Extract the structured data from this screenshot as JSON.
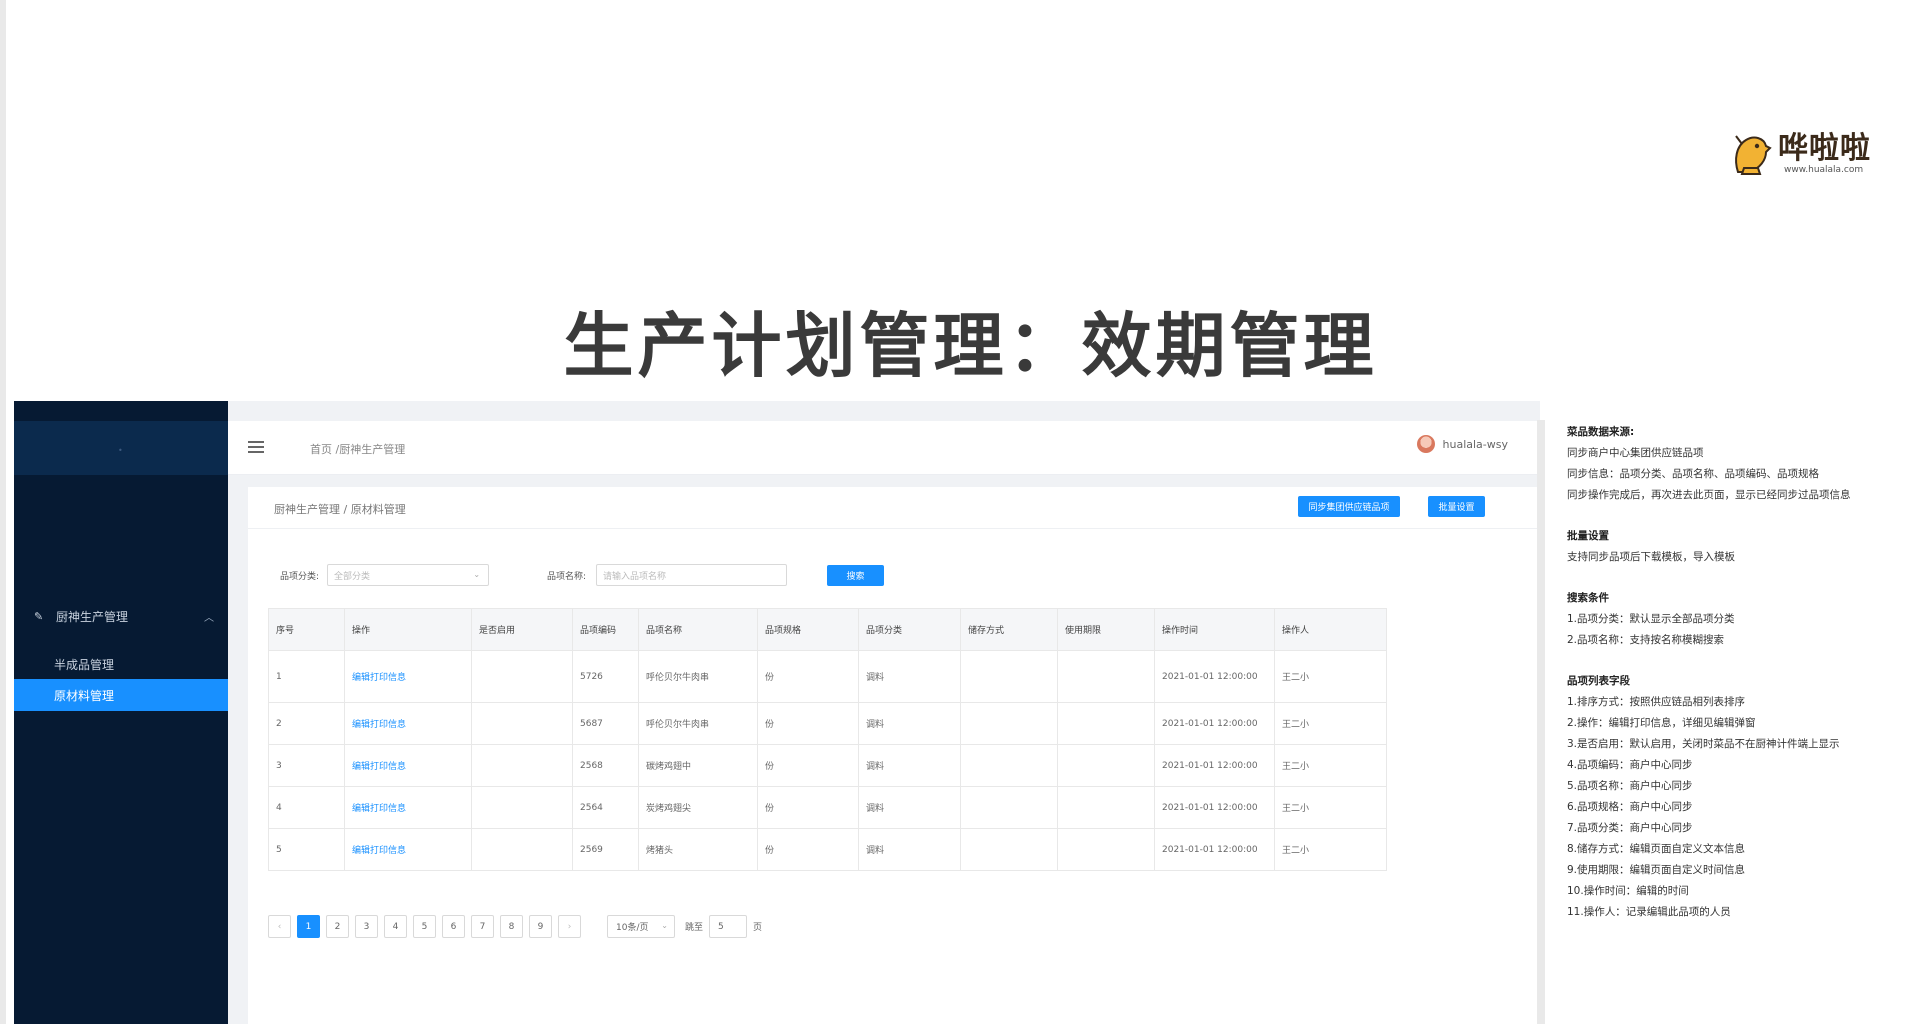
{
  "slide": {
    "title": "生产计划管理：效期管理",
    "logo": {
      "name": "哗啦啦",
      "url": "www.hualala.com"
    }
  },
  "sidebar": {
    "group": {
      "label": "厨神生产管理",
      "icon": "edit-icon"
    },
    "items": [
      {
        "label": "半成品管理",
        "active": false
      },
      {
        "label": "原材料管理",
        "active": true
      }
    ]
  },
  "topbar": {
    "breadcrumb": "首页 /厨神生产管理",
    "username": "hualala-wsy"
  },
  "card": {
    "breadcrumb": "厨神生产管理 / 原材料管理",
    "sync_button": "同步集团供应链品项",
    "batch_button": "批量设置"
  },
  "filters": {
    "category_label": "品项分类:",
    "category_placeholder": "全部分类",
    "name_label": "品项名称:",
    "name_placeholder": "请输入品项名称",
    "search_button": "搜索"
  },
  "table": {
    "columns": [
      "序号",
      "操作",
      "是否启用",
      "品项编码",
      "品项名称",
      "品项规格",
      "品项分类",
      "储存方式",
      "使用期限",
      "操作时间",
      "操作人"
    ],
    "rows": [
      [
        "1",
        "编辑打印信息",
        "",
        "5726",
        "呼伦贝尔牛肉串",
        "份",
        "调料",
        "",
        "",
        "2021-01-01 12:00:00",
        "王二小"
      ],
      [
        "2",
        "编辑打印信息",
        "",
        "5687",
        "呼伦贝尔牛肉串",
        "份",
        "调料",
        "",
        "",
        "2021-01-01 12:00:00",
        "王二小"
      ],
      [
        "3",
        "编辑打印信息",
        "",
        "2568",
        "碳烤鸡翅中",
        "份",
        "调料",
        "",
        "",
        "2021-01-01 12:00:00",
        "王二小"
      ],
      [
        "4",
        "编辑打印信息",
        "",
        "2564",
        "炭烤鸡翅尖",
        "份",
        "调料",
        "",
        "",
        "2021-01-01 12:00:00",
        "王二小"
      ],
      [
        "5",
        "编辑打印信息",
        "",
        "2569",
        "烤猪头",
        "份",
        "调料",
        "",
        "",
        "2021-01-01 12:00:00",
        "王二小"
      ]
    ]
  },
  "pagination": {
    "pages": [
      "1",
      "2",
      "3",
      "4",
      "5",
      "6",
      "7",
      "8",
      "9"
    ],
    "current": "1",
    "prev": "‹",
    "next": "›",
    "page_size": "10条/页",
    "jump_label": "跳至",
    "jump_value": "5",
    "jump_suffix": "页"
  },
  "notes": [
    {
      "heading": "菜品数据来源:",
      "lines": [
        "同步商户中心集团供应链品项",
        "同步信息：品项分类、品项名称、品项编码、品项规格",
        "同步操作完成后，再次进去此页面，显示已经同步过品项信息"
      ]
    },
    {
      "heading": "批量设置",
      "lines": [
        "支持同步品项后下载模板，导入模板"
      ]
    },
    {
      "heading": "搜索条件",
      "lines": [
        "1.品项分类：默认显示全部品项分类",
        "2.品项名称：支持按名称模糊搜索"
      ]
    },
    {
      "heading": "品项列表字段",
      "lines": [
        "1.排序方式：按照供应链品相列表排序",
        "2.操作：编辑打印信息，详细见编辑弹窗",
        "3.是否启用：默认启用，关闭时菜品不在厨神计件端上显示",
        "4.品项编码：商户中心同步",
        "5.品项名称：商户中心同步",
        "6.品项规格：商户中心同步",
        "7.品项分类：商户中心同步",
        "8.储存方式：编辑页面自定义文本信息",
        "9.使用期限：编辑页面自定义时间信息",
        "10.操作时间：编辑的时间",
        "11.操作人：记录编辑此品项的人员"
      ]
    }
  ],
  "colors": {
    "primary": "#1890ff",
    "sidebar": "#061a33",
    "sidebar_head": "#0b2a4d"
  }
}
